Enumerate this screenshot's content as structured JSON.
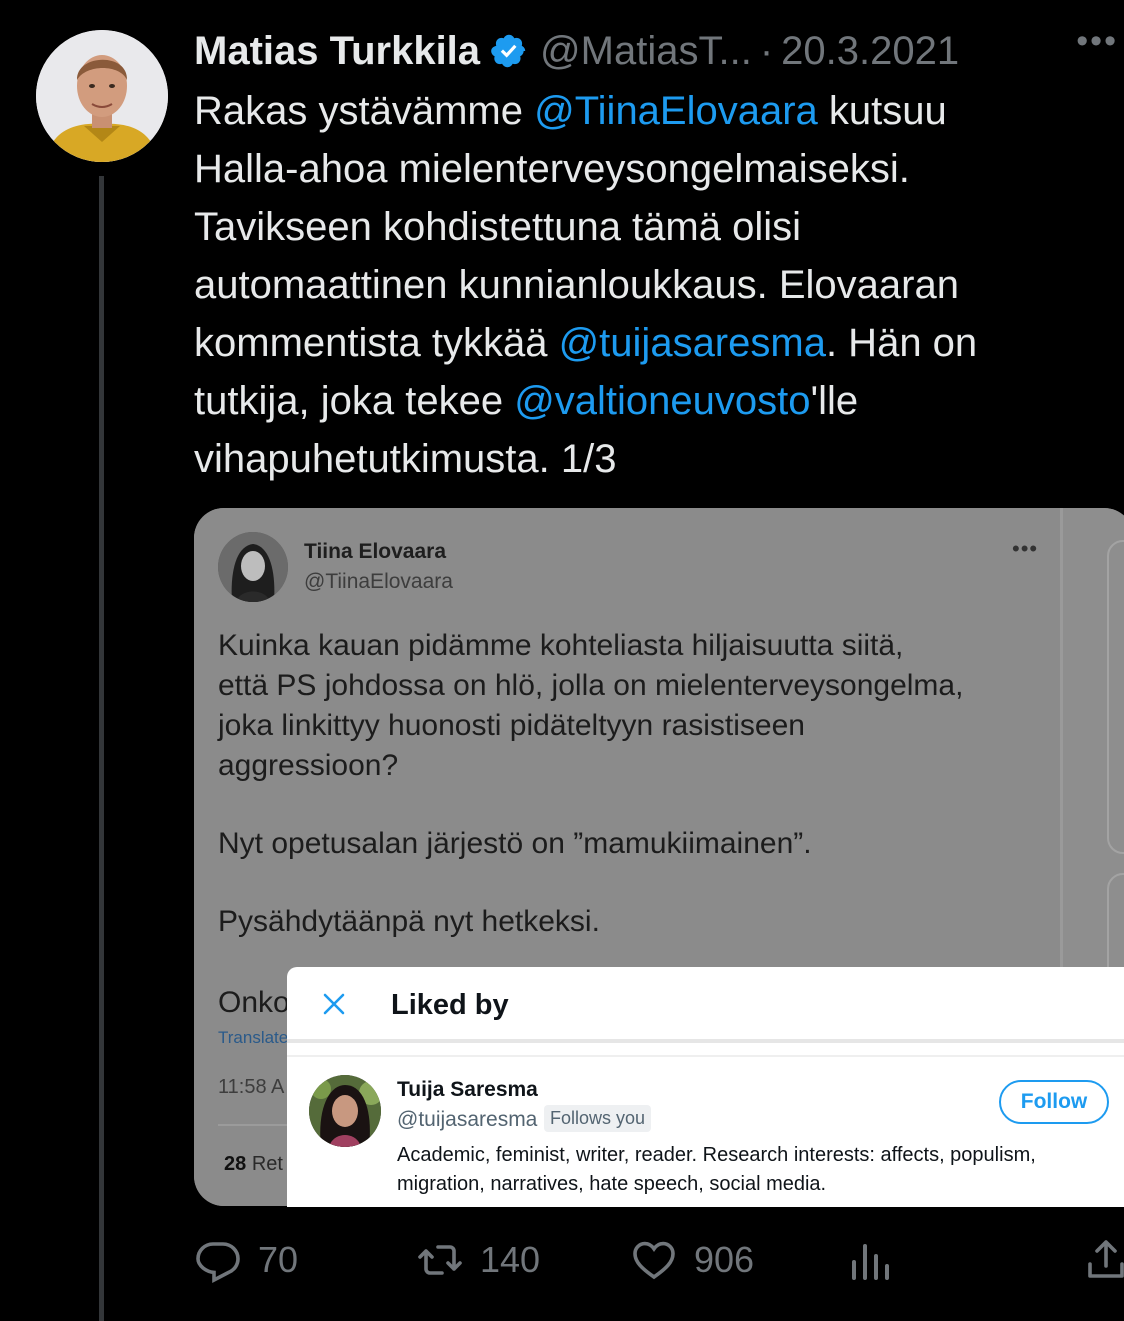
{
  "tweet": {
    "author_name": "Matias Turkkila",
    "handle": "@MatiasT...",
    "separator": "·",
    "date": "20.3.2021",
    "more": "•••",
    "text_lines": [
      [
        {
          "t": "Rakas ystävämme "
        },
        {
          "t": "@TiinaElovaara",
          "m": true
        },
        {
          "t": " kutsuu"
        }
      ],
      [
        {
          "t": "Halla-ahoa mielenterveysongelmaiseksi."
        }
      ],
      [
        {
          "t": "Tavikseen kohdistettuna tämä olisi"
        }
      ],
      [
        {
          "t": "automaattinen kunnianloukkaus. Elovaaran"
        }
      ],
      [
        {
          "t": "kommentista tykkää "
        },
        {
          "t": "@tuijasaresma",
          "m": true
        },
        {
          "t": ". Hän on"
        }
      ],
      [
        {
          "t": "tutkija, joka tekee "
        },
        {
          "t": "@valtioneuvosto",
          "m": true
        },
        {
          "t": "'lle"
        }
      ],
      [
        {
          "t": "vihapuhetutkimusta. 1/3"
        }
      ]
    ],
    "mention_color": "#1d9bf0"
  },
  "embedded": {
    "name": "Tiina Elovaara",
    "handle": "@TiinaElovaara",
    "more": "•••",
    "para1": [
      "Kuinka kauan pidämme kohteliasta hiljaisuutta siitä,",
      "että PS johdossa on hlö, jolla on mielenterveysongelma,",
      "joka linkittyy huonosti pidäteltyyn rasistiseen",
      "aggressioon?"
    ],
    "para2": "Nyt opetusalan järjestö on ”mamukiimainen”.",
    "para3": "Pysähdytäänpä nyt hetkeksi.",
    "partial_line": "Onko",
    "translate": "Translate",
    "time": "11:58 A",
    "retweets_count": "28",
    "retweets_label": "Ret"
  },
  "liked_by": {
    "title": "Liked by",
    "user": {
      "name": "Tuija Saresma",
      "handle": "@tuijasaresma",
      "badge": "Follows you",
      "bio_lines": [
        "Academic, feminist, writer, reader. Research interests: affects, populism,",
        "migration, narratives, hate speech, social media."
      ],
      "follow_label": "Follow"
    }
  },
  "actions": {
    "replies": "70",
    "retweets": "140",
    "likes": "906"
  }
}
